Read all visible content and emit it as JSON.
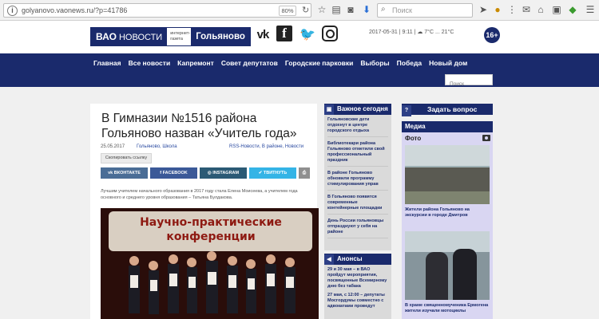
{
  "browser": {
    "url": "golyanovo.vaonews.ru/?p=41786",
    "zoom": "80%",
    "search_placeholder": "Поиск"
  },
  "header": {
    "logo_vao": "ВАО",
    "logo_novosti": "НОВОСТИ",
    "logo_sub": "интернет-газета",
    "logo_district": "Гольяново",
    "weather": "2017-05-31 | 9:11 |  ☁ 7°C ... 21°C",
    "age_badge": "16+"
  },
  "nav": {
    "items": [
      "Главная",
      "Все новости",
      "Капремонт",
      "Совет депутатов",
      "Городские парковки",
      "Выборы",
      "Победа",
      "Новый дом"
    ],
    "search_placeholder": "Поиск"
  },
  "article": {
    "title": "В Гимназии №1516 района Гольяново назван «Учитель года»",
    "date": "25.05.2017",
    "tags": "Гольяново, Школа",
    "categories": "RSS-Новости, В районе, Новости",
    "copy_label": "Скопировать ссылку",
    "share": {
      "vk": "ВКОНТАКТЕ",
      "fb": "FACEBOOK",
      "ig": "INSTAGRAM",
      "tw": "ТВИТНУТЬ"
    },
    "lead": "Лучшим учителем начального образования в 2017 году стала Елена Моисеева, а учителем года основного и среднего уровня образования – Татьяна Булдакова.",
    "photo_banner_line1": "Научно-практические",
    "photo_banner_line2": "конференции"
  },
  "today": {
    "heading": "Важное сегодня",
    "items": [
      "Гольяновские дети отдохнут в центре городского отдыха",
      "Библиотекари района Гольяново отметили свой профессиональный праздник",
      "В районе Гольяново обновили программу стимулирования управ",
      "В Гольяново появятся современные контейнерные площадки",
      "День России гольяновцы отпразднуют у себя на районе"
    ]
  },
  "announcements": {
    "heading": "Анонсы",
    "items": [
      "29 и 30 мая – в ВАО пройдут мероприятия, посвященные Всемирному дню без табака",
      "27 мая, с 12:00 – депутаты Мосгордумы совместно с адвокатами проведут"
    ]
  },
  "sidebar": {
    "ask_label": "Задать вопрос",
    "media_heading": "Медиа",
    "photo_label": "Фото",
    "captions": [
      "Жители района Гольяново на экскурсии в городе Дмитров",
      "В храме священномученика Ермогена жители изучали мотоциклы"
    ]
  }
}
